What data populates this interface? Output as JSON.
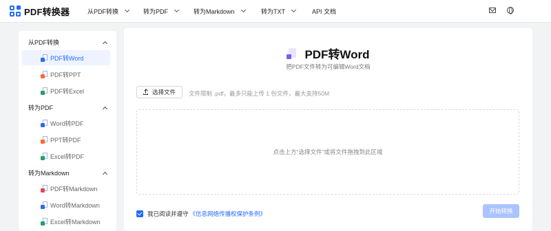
{
  "header": {
    "logo_text": "PDF转换器",
    "nav": [
      {
        "label": "从PDF转换"
      },
      {
        "label": "转为PDF"
      },
      {
        "label": "转为Markdown"
      },
      {
        "label": "转为TXT"
      },
      {
        "label": "API 文档"
      }
    ],
    "icons": [
      "mail-icon",
      "globe-icon"
    ]
  },
  "sidebar": {
    "groups": [
      {
        "label": "从PDF转换",
        "items": [
          {
            "label": "PDF转Word",
            "active": true,
            "badge_color": "#2b6de8"
          },
          {
            "label": "PDF转PPT",
            "badge_color": "#ff6a2b"
          },
          {
            "label": "PDF转Excel",
            "badge_color": "#21a366"
          }
        ]
      },
      {
        "label": "转为PDF",
        "items": [
          {
            "label": "Word转PDF",
            "badge_color": "#2b6de8"
          },
          {
            "label": "PPT转PDF",
            "badge_color": "#ff6a2b"
          },
          {
            "label": "Excel转PDF",
            "badge_color": "#21a366"
          }
        ]
      },
      {
        "label": "转为Markdown",
        "items": [
          {
            "label": "PDF转Markdown",
            "badge_color": "#e5484d"
          },
          {
            "label": "Word转Markdown",
            "badge_color": "#2b6de8"
          },
          {
            "label": "Excel转Markdown",
            "badge_color": "#21a366"
          }
        ]
      }
    ]
  },
  "main": {
    "title": "PDF转Word",
    "subtitle": "把PDF文件转为可编辑Word文档",
    "choose_button": "选择文件",
    "hint": "文件限制 .pdf，最多只能上传 1 份文件，最大支持50M",
    "dropzone_text": "点击上方“选择文件”或将文件拖拽到此区域",
    "agree_text": "我已阅读并遵守",
    "agree_link": "《信息网络传播权保护条例》",
    "agree_checked": true,
    "start_button": "开始转换"
  },
  "colors": {
    "accent": "#1f6bff",
    "start_button_disabled": "#a9c4ff",
    "active_item_bg": "#eef3ff"
  }
}
